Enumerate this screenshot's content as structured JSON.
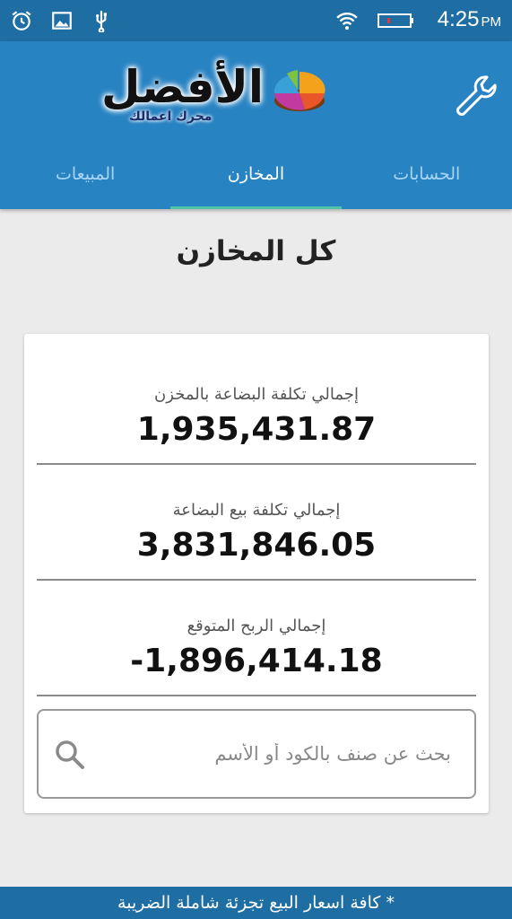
{
  "status_bar": {
    "time": "4:25",
    "ampm": "PM",
    "icons": [
      "alarm-clock-icon",
      "image-icon",
      "usb-icon",
      "wifi-icon",
      "battery-icon"
    ],
    "color": "#1e6ea3"
  },
  "header": {
    "logo_title": "الأفضل",
    "logo_subtitle": "محرك اعمالك",
    "settings_icon": "wrench-icon",
    "color": "#2883c3",
    "tabs": [
      {
        "label": "المبيعات",
        "active": false
      },
      {
        "label": "المخازن",
        "active": true
      },
      {
        "label": "الحسابات",
        "active": false
      }
    ]
  },
  "main": {
    "title": "كل المخازن",
    "stats": [
      {
        "label": "إجمالي تكلفة البضاعة بالمخزن",
        "value": "1,935,431.87"
      },
      {
        "label": "إجمالي تكلفة بيع البضاعة",
        "value": "3,831,846.05"
      },
      {
        "label": "إجمالي الربح المتوقع",
        "value": "-1,896,414.18"
      }
    ],
    "search": {
      "placeholder": "بحث عن صنف بالكود أو الأسم",
      "value": ""
    }
  },
  "footer": {
    "note": "* كافة اسعار البيع تجزئة شاملة الضريبة"
  }
}
